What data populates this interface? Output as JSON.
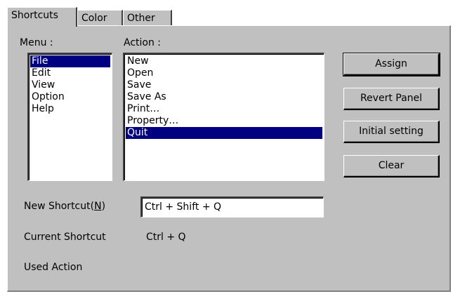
{
  "tabs": [
    {
      "label": "Shortcuts",
      "active": true
    },
    {
      "label": "Color",
      "active": false
    },
    {
      "label": "Other",
      "active": false
    }
  ],
  "menu": {
    "label": "Menu :",
    "items": [
      "File",
      "Edit",
      "View",
      "Option",
      "Help"
    ],
    "selected": "File"
  },
  "action": {
    "label": "Action :",
    "items": [
      "New",
      "Open",
      "Save",
      "Save As",
      "Print…",
      "Property…",
      "Quit"
    ],
    "selected": "Quit"
  },
  "buttons": {
    "assign": "Assign",
    "revert": "Revert Panel",
    "initial": "Initial setting",
    "clear": "Clear"
  },
  "new_shortcut": {
    "label_pre": "New Shortcut(",
    "label_key": "N",
    "label_post": ")",
    "value": "Ctrl + Shift + Q"
  },
  "current_shortcut": {
    "label": "Current Shortcut",
    "value": "Ctrl + Q"
  },
  "used_action": {
    "label": "Used Action",
    "value": ""
  },
  "colors": {
    "face": "#c0c0c0",
    "selection": "#000080"
  }
}
